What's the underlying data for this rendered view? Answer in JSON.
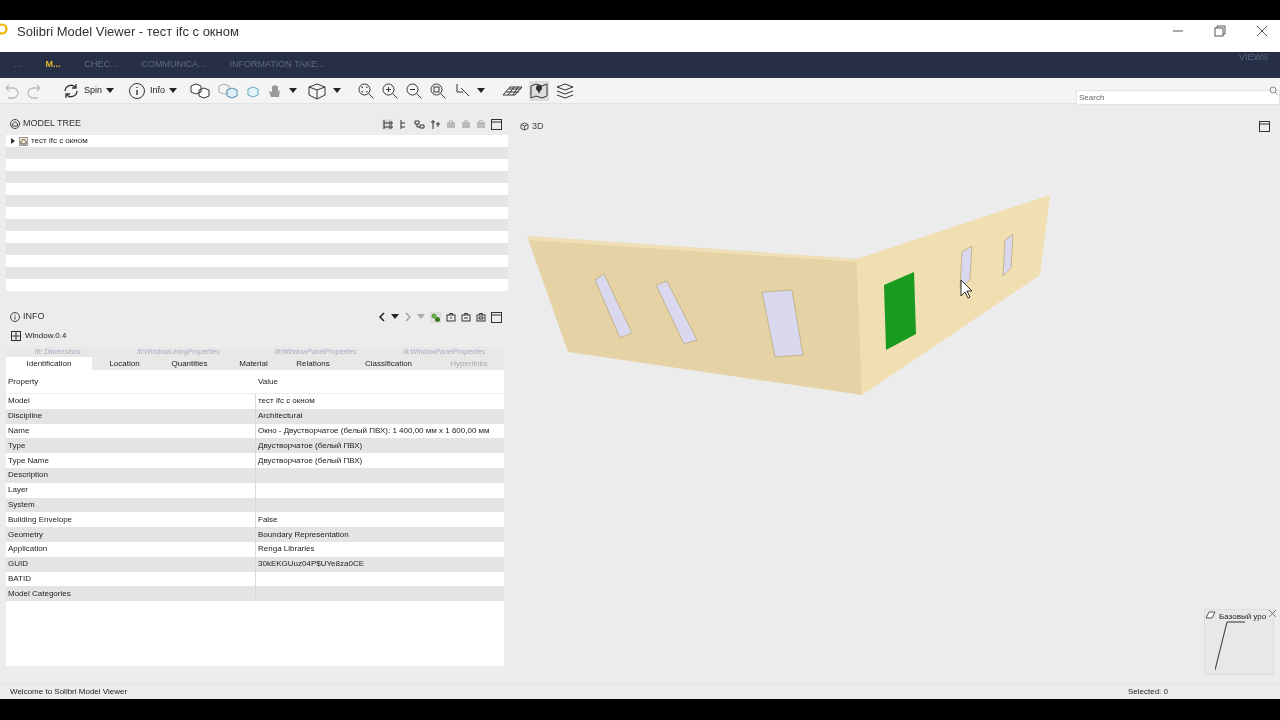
{
  "window": {
    "title": "Solibri Model Viewer - тест ifc с окном"
  },
  "menu_tabs": [
    {
      "label": "...",
      "selected": false
    },
    {
      "label": "M...",
      "selected": true
    },
    {
      "label": "CHEC...",
      "selected": false
    },
    {
      "label": "COMMUNICA...",
      "selected": false
    },
    {
      "label": "INFORMATION TAKE...",
      "selected": false
    }
  ],
  "views_label": "VIEWS",
  "toolbar": {
    "spin_label": "Spin",
    "info_label": "Info"
  },
  "search": {
    "placeholder": "Search"
  },
  "model_tree": {
    "title": "MODEL TREE",
    "items": [
      {
        "label": "тест ifc с окном",
        "expanded": false
      }
    ]
  },
  "info": {
    "title": "INFO",
    "selection": "Window.0.4",
    "property_set_tabs": [
      "Ifc Dimensions",
      "IfcWindowLiningProperties",
      "IfcWindowPanelProperties",
      "IfcWindowPanelProperties"
    ],
    "tabs": [
      {
        "label": "Identification",
        "selected": true,
        "disabled": false
      },
      {
        "label": "Location",
        "selected": false,
        "disabled": false
      },
      {
        "label": "Quantities",
        "selected": false,
        "disabled": false
      },
      {
        "label": "Material",
        "selected": false,
        "disabled": false
      },
      {
        "label": "Relations",
        "selected": false,
        "disabled": false
      },
      {
        "label": "Classification",
        "selected": false,
        "disabled": false
      },
      {
        "label": "Hyperlinks",
        "selected": false,
        "disabled": true
      }
    ],
    "table": {
      "columns": [
        "Property",
        "Value"
      ],
      "rows": [
        [
          "Model",
          "тест ifc с окном"
        ],
        [
          "Discipline",
          "Architectural"
        ],
        [
          "Name",
          "Окно - Двустворчатое (белый ПВХ): 1 400,00 мм x 1 600,00 мм"
        ],
        [
          "Type",
          "Двустворчатое (белый ПВХ)"
        ],
        [
          "Type Name",
          "Двустворчатое (белый ПВХ)"
        ],
        [
          "Description",
          ""
        ],
        [
          "Layer",
          ""
        ],
        [
          "System",
          ""
        ],
        [
          "Building Envelope",
          "False"
        ],
        [
          "Geometry",
          "Boundary Representation"
        ],
        [
          "Application",
          "Renga Libraries"
        ],
        [
          "GUID",
          "30kEKGUuz04P$UYe8za0CE"
        ],
        [
          "BATID",
          ""
        ],
        [
          "Model Categories",
          ""
        ]
      ]
    }
  },
  "view": {
    "title": "3D",
    "level_label": "Базовый уро"
  },
  "status_bar": {
    "message": "Welcome to Solibri Model Viewer",
    "selected": "Selected: 0"
  }
}
